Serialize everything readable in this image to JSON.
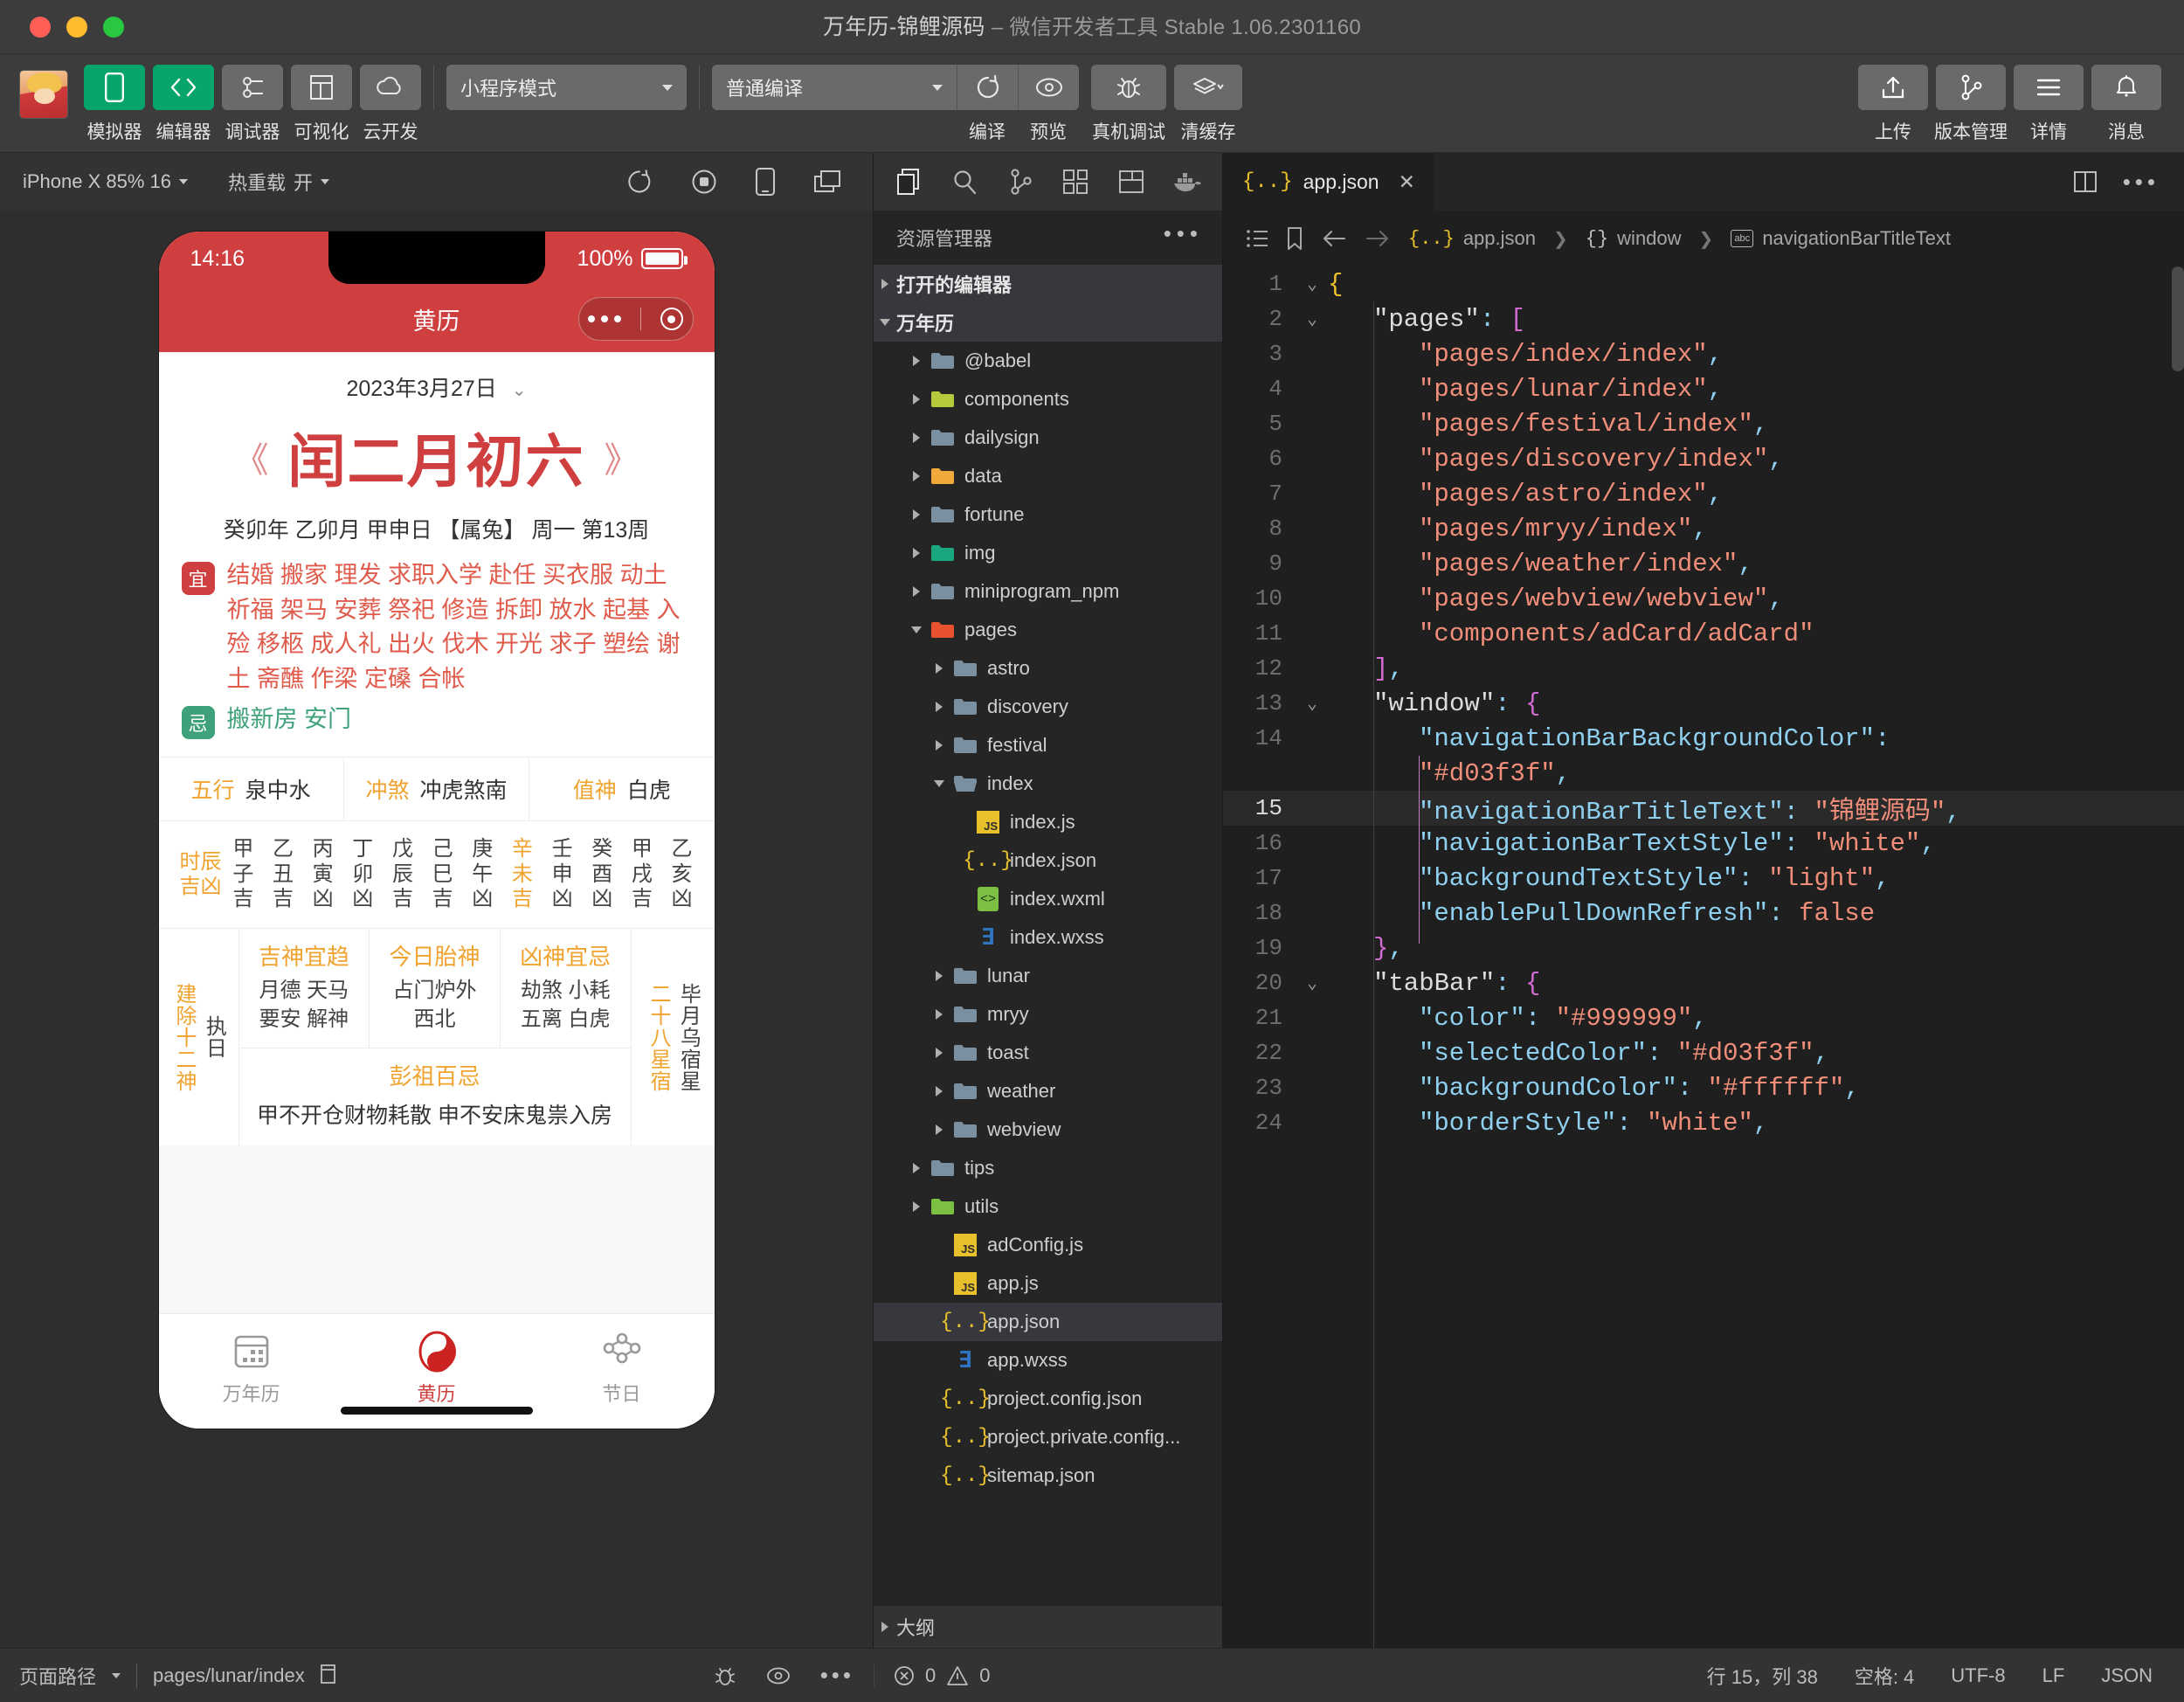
{
  "window": {
    "title": "万年历-锦鲤源码",
    "subtitle": "– 微信开发者工具 Stable 1.06.2301160"
  },
  "toolbar": {
    "buttons": [
      {
        "label": "模拟器",
        "icon": "phone-icon",
        "accent": true
      },
      {
        "label": "编辑器",
        "icon": "code-icon",
        "accent": true
      },
      {
        "label": "调试器",
        "icon": "debugger-icon",
        "accent": false
      },
      {
        "label": "可视化",
        "icon": "layout-icon",
        "accent": false
      },
      {
        "label": "云开发",
        "icon": "cloud-icon",
        "accent": false
      }
    ],
    "mode_select": "小程序模式",
    "compile_select": "普通编译",
    "actions": [
      {
        "label": "编译",
        "icon": "refresh-icon"
      },
      {
        "label": "预览",
        "icon": "eye-icon"
      },
      {
        "label": "真机调试",
        "icon": "bug-icon"
      },
      {
        "label": "清缓存",
        "icon": "layers-icon"
      }
    ],
    "right_actions": [
      {
        "label": "上传",
        "icon": "upload-icon"
      },
      {
        "label": "版本管理",
        "icon": "branch-icon"
      },
      {
        "label": "详情",
        "icon": "menu-icon"
      },
      {
        "label": "消息",
        "icon": "bell-icon"
      }
    ]
  },
  "simulator": {
    "device_select": "iPhone X 85% 16",
    "hotreload_label": "热重载",
    "hotreload_value": "开",
    "icons": [
      "refresh-icon",
      "record-icon",
      "device-icon",
      "split-icon"
    ],
    "phone": {
      "status_time": "14:16",
      "battery_percent": "100%",
      "nav_title": "黄历",
      "date": "2023年3月27日",
      "lunar_big": "闰二月初六",
      "ganzhi": "癸卯年 乙卯月 甲申日 【属兔】 周一 第13周",
      "yi_badge": "宜",
      "yi_text": "结婚 搬家 理发 求职入学 赴任 买衣服 动土 祈福 架马 安葬 祭祀 修造 拆卸 放水 起基 入殓 移柩 成人礼 出火 伐木 开光 求子 塑绘 谢土 斋醮 作梁 定磉 合帐",
      "ji_badge": "忌",
      "ji_text": "搬新房 安门",
      "info_cells": [
        {
          "label": "五行",
          "value": "泉中水"
        },
        {
          "label": "冲煞",
          "value": "冲虎煞南"
        },
        {
          "label": "值神",
          "value": "白虎"
        }
      ],
      "shichen_label": "时辰吉凶",
      "shichen": [
        {
          "stem": "甲",
          "branch": "子",
          "luck": "吉",
          "highlight": false
        },
        {
          "stem": "乙",
          "branch": "丑",
          "luck": "吉",
          "highlight": false
        },
        {
          "stem": "丙",
          "branch": "寅",
          "luck": "凶",
          "highlight": false
        },
        {
          "stem": "丁",
          "branch": "卯",
          "luck": "凶",
          "highlight": false
        },
        {
          "stem": "戊",
          "branch": "辰",
          "luck": "吉",
          "highlight": false
        },
        {
          "stem": "己",
          "branch": "巳",
          "luck": "吉",
          "highlight": false
        },
        {
          "stem": "庚",
          "branch": "午",
          "luck": "凶",
          "highlight": false
        },
        {
          "stem": "辛",
          "branch": "未",
          "luck": "吉",
          "highlight": true
        },
        {
          "stem": "壬",
          "branch": "申",
          "luck": "凶",
          "highlight": false
        },
        {
          "stem": "癸",
          "branch": "酉",
          "luck": "凶",
          "highlight": false
        },
        {
          "stem": "甲",
          "branch": "戌",
          "luck": "吉",
          "highlight": false
        },
        {
          "stem": "乙",
          "branch": "亥",
          "luck": "凶",
          "highlight": false
        }
      ],
      "jianchu_label": "建除十二神",
      "jianchu_value": "执日",
      "cells": [
        {
          "head": "吉神宜趋",
          "value": "月德 天马\n要安 解神"
        },
        {
          "head": "今日胎神",
          "value": "占门炉外\n西北"
        },
        {
          "head": "凶神宜忌",
          "value": "劫煞 小耗\n五离 白虎"
        }
      ],
      "pengzu_head": "彭祖百忌",
      "pengzu_value": "甲不开仓财物耗散 申不安床鬼祟入房",
      "xingxiu_label": "二十八星宿",
      "xingxiu_value": "毕月乌宿星",
      "tabs": [
        {
          "label": "万年历",
          "icon": "calendar-icon",
          "active": false
        },
        {
          "label": "黄历",
          "icon": "yinyang-icon",
          "active": true
        },
        {
          "label": "节日",
          "icon": "festival-icon",
          "active": false
        }
      ]
    }
  },
  "explorer": {
    "activity_icons": [
      "files-icon",
      "search-icon",
      "source-control-icon",
      "extensions-icon",
      "debug-icon",
      "docker-icon"
    ],
    "title": "资源管理器",
    "more_icon": "ellipsis-icon",
    "sections": [
      {
        "label": "打开的编辑器",
        "expanded": false
      },
      {
        "label": "万年历",
        "expanded": true
      }
    ],
    "tree": [
      {
        "name": "@babel",
        "type": "folder",
        "depth": 1,
        "expanded": false,
        "color": "#7a8fa0"
      },
      {
        "name": "components",
        "type": "folder-special",
        "depth": 1,
        "expanded": false,
        "color": "#b7c93d"
      },
      {
        "name": "dailysign",
        "type": "folder",
        "depth": 1,
        "expanded": false,
        "color": "#7a8fa0"
      },
      {
        "name": "data",
        "type": "folder-special",
        "depth": 1,
        "expanded": false,
        "color": "#f0a93a"
      },
      {
        "name": "fortune",
        "type": "folder",
        "depth": 1,
        "expanded": false,
        "color": "#7a8fa0"
      },
      {
        "name": "img",
        "type": "folder-special",
        "depth": 1,
        "expanded": false,
        "color": "#1aa77f"
      },
      {
        "name": "miniprogram_npm",
        "type": "folder",
        "depth": 1,
        "expanded": false,
        "color": "#7a8fa0"
      },
      {
        "name": "pages",
        "type": "folder-special",
        "depth": 1,
        "expanded": true,
        "color": "#e8522e"
      },
      {
        "name": "astro",
        "type": "folder",
        "depth": 2,
        "expanded": false,
        "color": "#7a8fa0"
      },
      {
        "name": "discovery",
        "type": "folder",
        "depth": 2,
        "expanded": false,
        "color": "#7a8fa0"
      },
      {
        "name": "festival",
        "type": "folder",
        "depth": 2,
        "expanded": false,
        "color": "#7a8fa0"
      },
      {
        "name": "index",
        "type": "folder-open",
        "depth": 2,
        "expanded": true,
        "color": "#7a8fa0"
      },
      {
        "name": "index.js",
        "type": "js",
        "depth": 3
      },
      {
        "name": "index.json",
        "type": "json",
        "depth": 3
      },
      {
        "name": "index.wxml",
        "type": "wxml",
        "depth": 3
      },
      {
        "name": "index.wxss",
        "type": "wxss",
        "depth": 3
      },
      {
        "name": "lunar",
        "type": "folder",
        "depth": 2,
        "expanded": false,
        "color": "#7a8fa0"
      },
      {
        "name": "mryy",
        "type": "folder",
        "depth": 2,
        "expanded": false,
        "color": "#7a8fa0"
      },
      {
        "name": "toast",
        "type": "folder",
        "depth": 2,
        "expanded": false,
        "color": "#7a8fa0"
      },
      {
        "name": "weather",
        "type": "folder",
        "depth": 2,
        "expanded": false,
        "color": "#7a8fa0"
      },
      {
        "name": "webview",
        "type": "folder",
        "depth": 2,
        "expanded": false,
        "color": "#7a8fa0"
      },
      {
        "name": "tips",
        "type": "folder",
        "depth": 1,
        "expanded": false,
        "color": "#7a8fa0"
      },
      {
        "name": "utils",
        "type": "folder-special",
        "depth": 1,
        "expanded": false,
        "color": "#7bc043"
      },
      {
        "name": "adConfig.js",
        "type": "js",
        "depth": 2
      },
      {
        "name": "app.js",
        "type": "js",
        "depth": 2
      },
      {
        "name": "app.json",
        "type": "json",
        "depth": 2,
        "selected": true
      },
      {
        "name": "app.wxss",
        "type": "wxss",
        "depth": 2
      },
      {
        "name": "project.config.json",
        "type": "json",
        "depth": 2
      },
      {
        "name": "project.private.config...",
        "type": "json",
        "depth": 2
      },
      {
        "name": "sitemap.json",
        "type": "json",
        "depth": 2
      }
    ],
    "outline_label": "大纲"
  },
  "editor": {
    "tab": {
      "label": "app.json",
      "icon": "json-icon",
      "close_icon": "close-icon"
    },
    "tab_actions": [
      "split-editor-icon",
      "more-actions-icon"
    ],
    "breadcrumb_icons": [
      "outline-list-icon",
      "bookmark-icon",
      "back-arrow-icon",
      "forward-arrow-icon"
    ],
    "breadcrumb": [
      "app.json",
      "window",
      "navigationBarTitleText"
    ],
    "lines": [
      {
        "n": 1,
        "fold": "open",
        "indent": 0,
        "segs": [
          {
            "t": "{",
            "c": "brkY"
          }
        ]
      },
      {
        "n": 2,
        "fold": "open",
        "indent": 1,
        "segs": [
          {
            "t": "\"pages\"",
            "c": "k-top"
          },
          {
            "t": ": ",
            "c": "punc"
          },
          {
            "t": "[",
            "c": "brkP"
          }
        ]
      },
      {
        "n": 3,
        "fold": "",
        "indent": 2,
        "segs": [
          {
            "t": "\"pages/index/index\"",
            "c": "str"
          },
          {
            "t": ",",
            "c": "punc"
          }
        ]
      },
      {
        "n": 4,
        "fold": "",
        "indent": 2,
        "segs": [
          {
            "t": "\"pages/lunar/index\"",
            "c": "str"
          },
          {
            "t": ",",
            "c": "punc"
          }
        ]
      },
      {
        "n": 5,
        "fold": "",
        "indent": 2,
        "segs": [
          {
            "t": "\"pages/festival/index\"",
            "c": "str"
          },
          {
            "t": ",",
            "c": "punc"
          }
        ]
      },
      {
        "n": 6,
        "fold": "",
        "indent": 2,
        "segs": [
          {
            "t": "\"pages/discovery/index\"",
            "c": "str"
          },
          {
            "t": ",",
            "c": "punc"
          }
        ]
      },
      {
        "n": 7,
        "fold": "",
        "indent": 2,
        "segs": [
          {
            "t": "\"pages/astro/index\"",
            "c": "str"
          },
          {
            "t": ",",
            "c": "punc"
          }
        ]
      },
      {
        "n": 8,
        "fold": "",
        "indent": 2,
        "segs": [
          {
            "t": "\"pages/mryy/index\"",
            "c": "str"
          },
          {
            "t": ",",
            "c": "punc"
          }
        ]
      },
      {
        "n": 9,
        "fold": "",
        "indent": 2,
        "segs": [
          {
            "t": "\"pages/weather/index\"",
            "c": "str"
          },
          {
            "t": ",",
            "c": "punc"
          }
        ]
      },
      {
        "n": 10,
        "fold": "",
        "indent": 2,
        "segs": [
          {
            "t": "\"pages/webview/webview\"",
            "c": "str"
          },
          {
            "t": ",",
            "c": "punc"
          }
        ]
      },
      {
        "n": 11,
        "fold": "",
        "indent": 2,
        "segs": [
          {
            "t": "\"components/adCard/adCard\"",
            "c": "str"
          }
        ]
      },
      {
        "n": 12,
        "fold": "",
        "indent": 1,
        "segs": [
          {
            "t": "]",
            "c": "brkP"
          },
          {
            "t": ",",
            "c": "punc"
          }
        ]
      },
      {
        "n": 13,
        "fold": "open",
        "indent": 1,
        "segs": [
          {
            "t": "\"window\"",
            "c": "k-top"
          },
          {
            "t": ": ",
            "c": "punc"
          },
          {
            "t": "{",
            "c": "brkP"
          }
        ]
      },
      {
        "n": 14,
        "fold": "",
        "indent": 2,
        "segs": [
          {
            "t": "\"navigationBarBackgroundColor\"",
            "c": "k-nest"
          },
          {
            "t": ":",
            "c": "punc"
          }
        ]
      },
      {
        "n": "",
        "fold": "",
        "indent": 2,
        "segs": [
          {
            "t": "\"#d03f3f\"",
            "c": "str"
          },
          {
            "t": ",",
            "c": "punc"
          }
        ]
      },
      {
        "n": 15,
        "fold": "",
        "indent": 2,
        "hl": true,
        "segs": [
          {
            "t": "\"navigationBarTitleText\"",
            "c": "k-nest"
          },
          {
            "t": ": ",
            "c": "punc"
          },
          {
            "t": "\"锦鲤源码\"",
            "c": "str"
          },
          {
            "t": ",",
            "c": "punc"
          }
        ]
      },
      {
        "n": 16,
        "fold": "",
        "indent": 2,
        "segs": [
          {
            "t": "\"navigationBarTextStyle\"",
            "c": "k-nest"
          },
          {
            "t": ": ",
            "c": "punc"
          },
          {
            "t": "\"white\"",
            "c": "str"
          },
          {
            "t": ",",
            "c": "punc"
          }
        ]
      },
      {
        "n": 17,
        "fold": "",
        "indent": 2,
        "segs": [
          {
            "t": "\"backgroundTextStyle\"",
            "c": "k-nest"
          },
          {
            "t": ": ",
            "c": "punc"
          },
          {
            "t": "\"light\"",
            "c": "str"
          },
          {
            "t": ",",
            "c": "punc"
          }
        ]
      },
      {
        "n": 18,
        "fold": "",
        "indent": 2,
        "segs": [
          {
            "t": "\"enablePullDownRefresh\"",
            "c": "k-nest"
          },
          {
            "t": ": ",
            "c": "punc"
          },
          {
            "t": "false",
            "c": "str"
          }
        ]
      },
      {
        "n": 19,
        "fold": "",
        "indent": 1,
        "segs": [
          {
            "t": "}",
            "c": "brkP"
          },
          {
            "t": ",",
            "c": "punc"
          }
        ]
      },
      {
        "n": 20,
        "fold": "open",
        "indent": 1,
        "segs": [
          {
            "t": "\"tabBar\"",
            "c": "k-top"
          },
          {
            "t": ": ",
            "c": "punc"
          },
          {
            "t": "{",
            "c": "brkP"
          }
        ]
      },
      {
        "n": 21,
        "fold": "",
        "indent": 2,
        "segs": [
          {
            "t": "\"color\"",
            "c": "k-nest"
          },
          {
            "t": ": ",
            "c": "punc"
          },
          {
            "t": "\"#999999\"",
            "c": "str"
          },
          {
            "t": ",",
            "c": "punc"
          }
        ]
      },
      {
        "n": 22,
        "fold": "",
        "indent": 2,
        "segs": [
          {
            "t": "\"selectedColor\"",
            "c": "k-nest"
          },
          {
            "t": ": ",
            "c": "punc"
          },
          {
            "t": "\"#d03f3f\"",
            "c": "str"
          },
          {
            "t": ",",
            "c": "punc"
          }
        ]
      },
      {
        "n": 23,
        "fold": "",
        "indent": 2,
        "segs": [
          {
            "t": "\"backgroundColor\"",
            "c": "k-nest"
          },
          {
            "t": ": ",
            "c": "punc"
          },
          {
            "t": "\"#ffffff\"",
            "c": "str"
          },
          {
            "t": ",",
            "c": "punc"
          }
        ]
      },
      {
        "n": 24,
        "fold": "",
        "indent": 2,
        "segs": [
          {
            "t": "\"borderStyle\"",
            "c": "k-nest"
          },
          {
            "t": ": ",
            "c": "punc"
          },
          {
            "t": "\"white\"",
            "c": "str"
          },
          {
            "t": ",",
            "c": "punc"
          }
        ]
      }
    ]
  },
  "statusbar": {
    "page_path_label": "页面路径",
    "page_path": "pages/lunar/index",
    "copy_icon": "copy-icon",
    "left_icons": [
      "bug-icon",
      "eye-icon",
      "ellipsis-icon"
    ],
    "errors": "0",
    "warnings": "0",
    "cursor": "行 15，列 38",
    "spaces": "空格: 4",
    "encoding": "UTF-8",
    "eol": "LF",
    "language": "JSON"
  },
  "colors": {
    "brand_red": "#d03f3f",
    "accent_green": "#07a46b",
    "gold": "#f0a32e"
  }
}
